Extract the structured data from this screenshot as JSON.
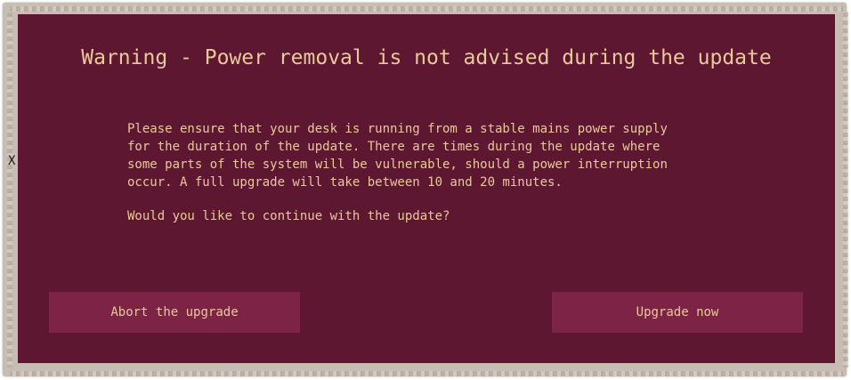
{
  "dialog": {
    "title": "Warning - Power removal is not advised during the update",
    "message": "Please ensure that your desk is running from a stable mains power supply\nfor the duration of the update. There are times during the update where\nsome parts of the system will be vulnerable, should a power interruption\noccur. A full upgrade will take between 10 and 20 minutes.",
    "question": "Would you like to continue with the update?",
    "abort_label": "Abort the upgrade",
    "upgrade_label": "Upgrade now"
  },
  "stray_mark": "X",
  "colors": {
    "background": "#5e1730",
    "button": "#7d2446",
    "text": "#e9c99c",
    "frame": "#c8bdb3"
  }
}
